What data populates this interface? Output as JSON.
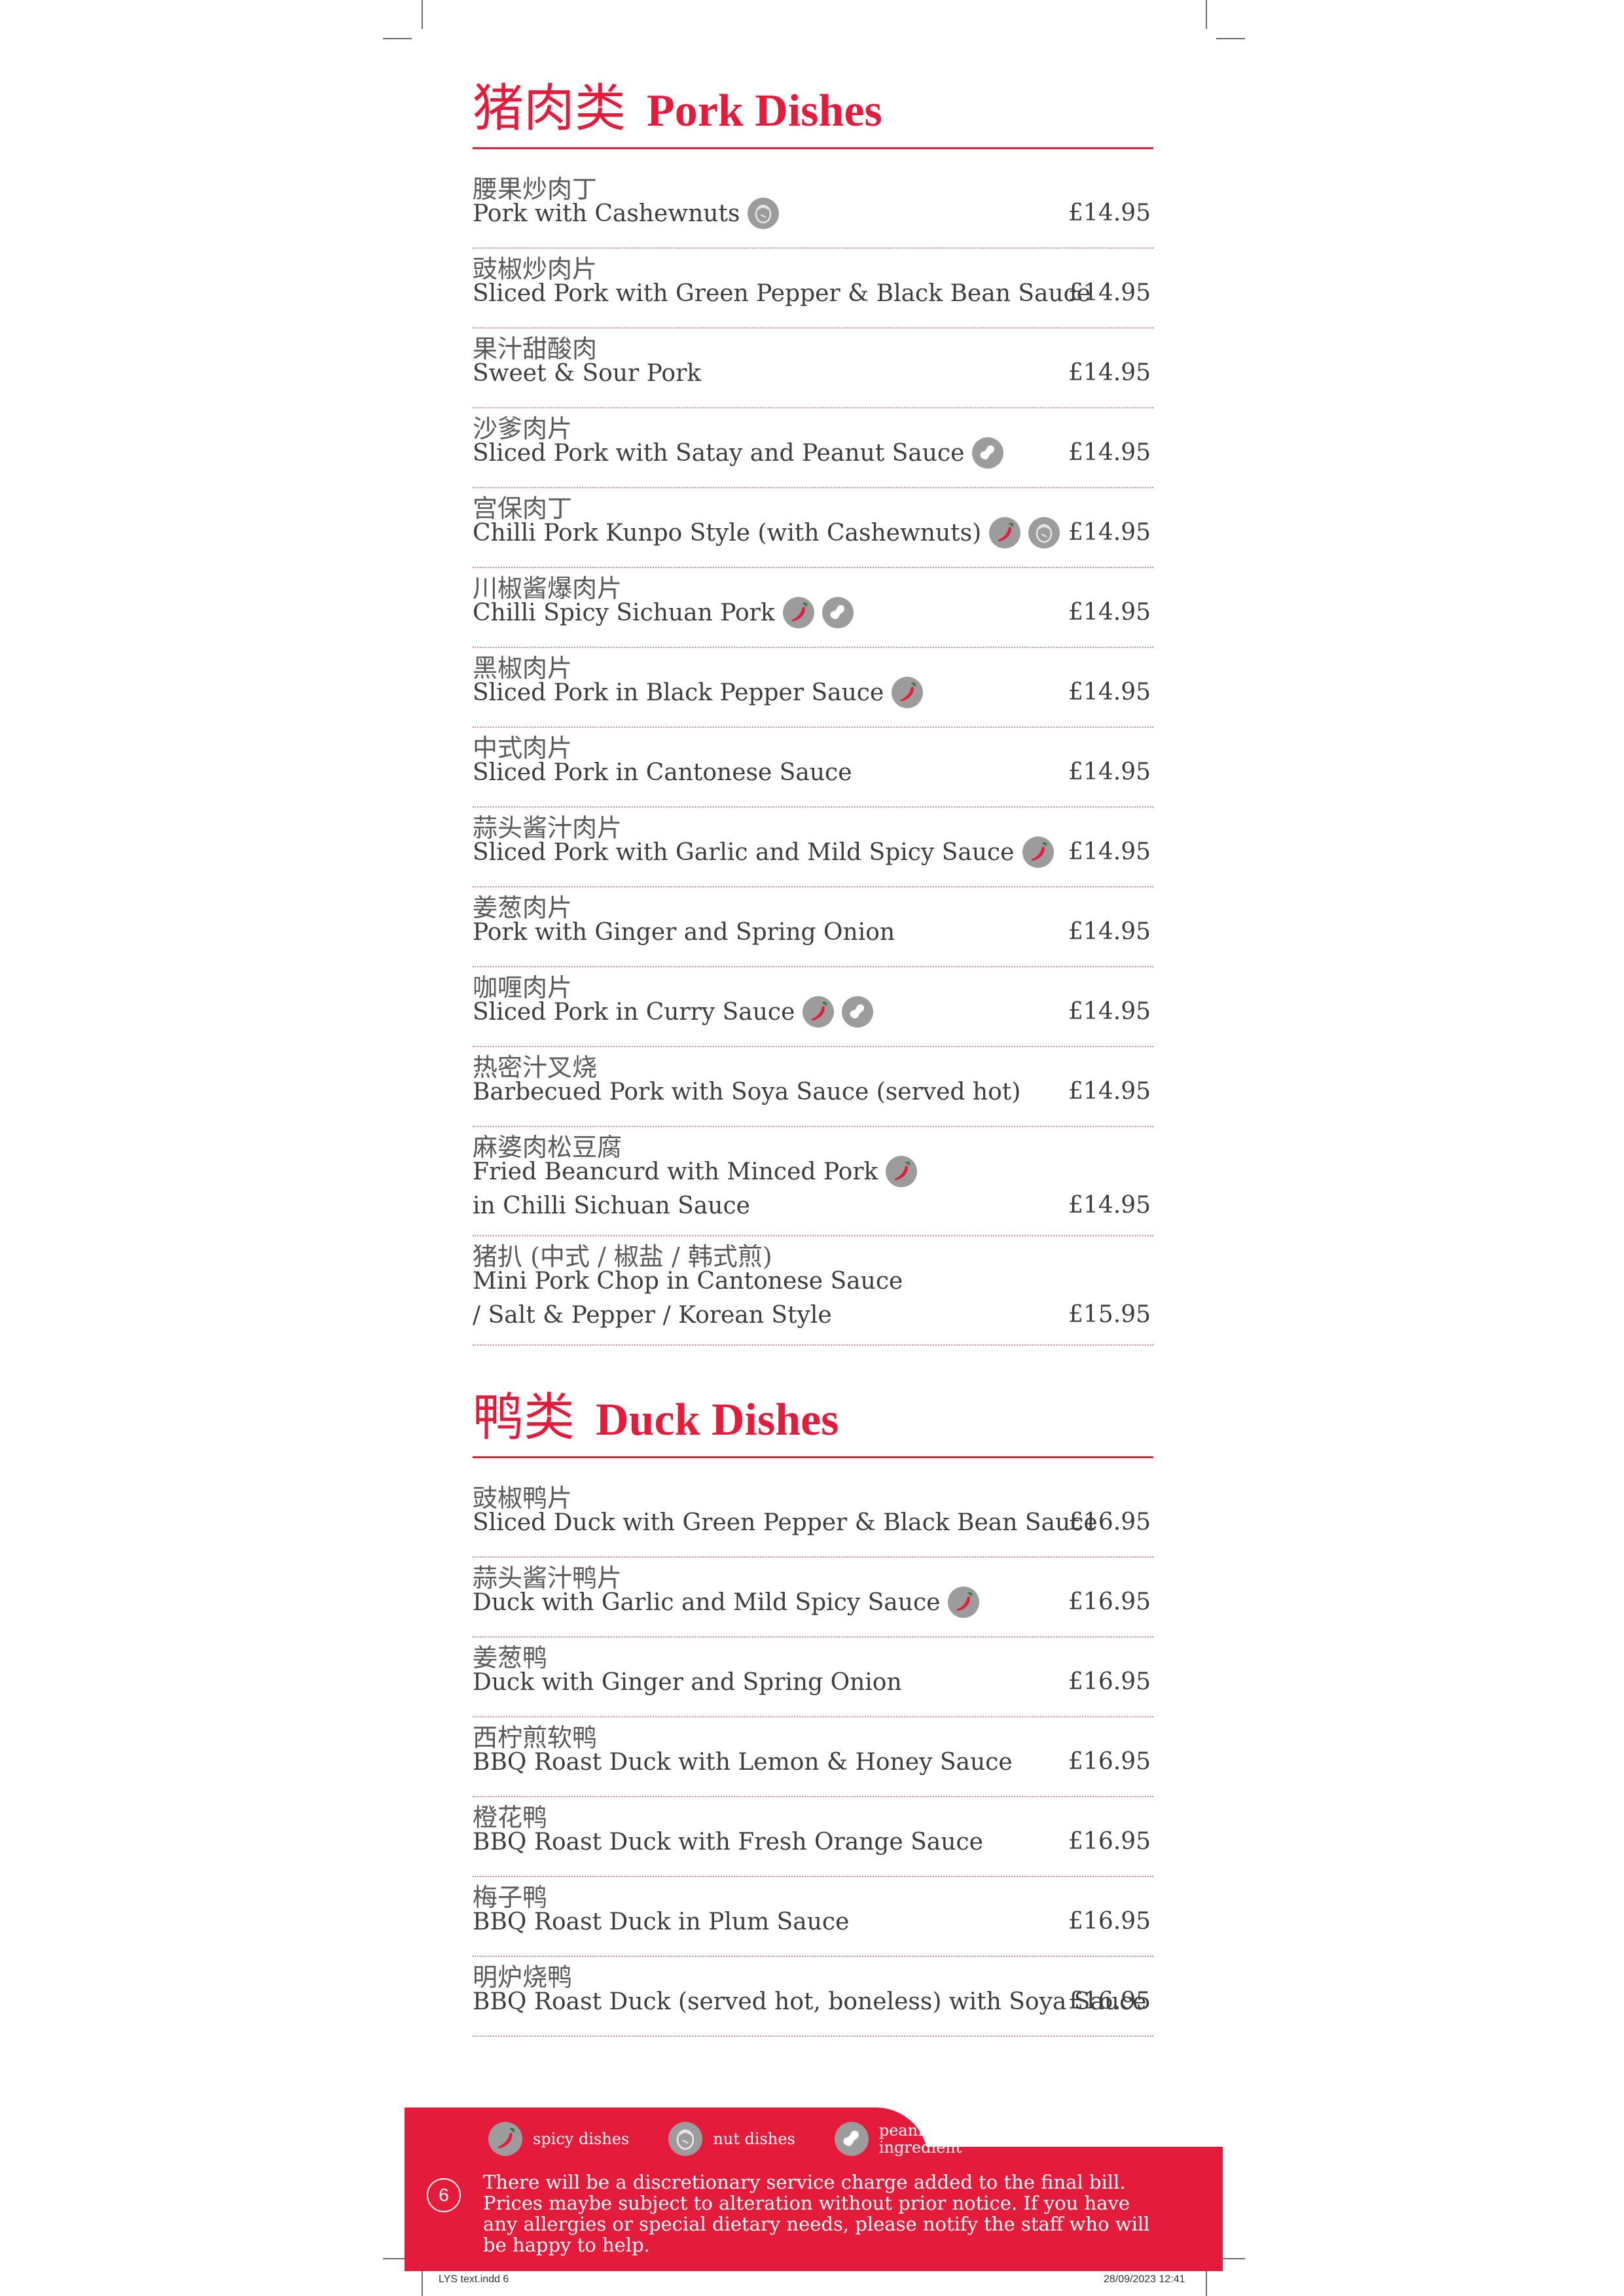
{
  "pork": {
    "title_zh": "猪肉类",
    "title_en": "Pork Dishes",
    "items": [
      {
        "zh": "腰果炒肉丁",
        "en": "Pork with Cashewnuts",
        "price": "£14.95",
        "icons": [
          "nut"
        ]
      },
      {
        "zh": "豉椒炒肉片",
        "en": "Sliced Pork with Green Pepper & Black Bean Sauce",
        "price": "£14.95",
        "icons": []
      },
      {
        "zh": "果汁甜酸肉",
        "en": "Sweet & Sour Pork",
        "price": "£14.95",
        "icons": []
      },
      {
        "zh": "沙爹肉片",
        "en": "Sliced Pork with Satay and Peanut Sauce",
        "price": "£14.95",
        "icons": [
          "peanut"
        ]
      },
      {
        "zh": "宫保肉丁",
        "en": "Chilli Pork Kunpo Style (with Cashewnuts)",
        "price": "£14.95",
        "icons": [
          "spicy",
          "nut"
        ]
      },
      {
        "zh": "川椒酱爆肉片",
        "en": "Chilli Spicy Sichuan Pork",
        "price": "£14.95",
        "icons": [
          "spicy",
          "peanut"
        ]
      },
      {
        "zh": "黑椒肉片",
        "en": "Sliced Pork in Black Pepper Sauce",
        "price": "£14.95",
        "icons": [
          "spicy"
        ]
      },
      {
        "zh": "中式肉片",
        "en": "Sliced Pork in Cantonese Sauce",
        "price": "£14.95",
        "icons": []
      },
      {
        "zh": "蒜头酱汁肉片",
        "en": "Sliced Pork with Garlic and Mild Spicy Sauce",
        "price": "£14.95",
        "icons": [
          "spicy"
        ]
      },
      {
        "zh": "姜葱肉片",
        "en": "Pork with Ginger and Spring Onion",
        "price": "£14.95",
        "icons": []
      },
      {
        "zh": "咖喱肉片",
        "en": "Sliced Pork in Curry Sauce",
        "price": "£14.95",
        "icons": [
          "spicy",
          "peanut"
        ]
      },
      {
        "zh": "热密汁叉烧",
        "en": "Barbecued Pork with Soya Sauce (served hot)",
        "price": "£14.95",
        "icons": []
      },
      {
        "zh": "麻婆肉松豆腐",
        "en": "Fried Beancurd with Minced Pork",
        "en2": "in Chilli Sichuan Sauce",
        "price": "£14.95",
        "icons": [
          "spicy"
        ]
      },
      {
        "zh": "猪扒 (中式 / 椒盐 / 韩式煎)",
        "en": "Mini Pork Chop in Cantonese Sauce",
        "en2": "/ Salt & Pepper / Korean Style",
        "price": "£15.95",
        "icons": []
      }
    ]
  },
  "duck": {
    "title_zh": "鸭类",
    "title_en": "Duck Dishes",
    "items": [
      {
        "zh": "豉椒鸭片",
        "en": "Sliced Duck with Green Pepper & Black Bean Sauce",
        "price": "£16.95",
        "icons": []
      },
      {
        "zh": "蒜头酱汁鸭片",
        "en": "Duck with Garlic and Mild Spicy Sauce",
        "price": "£16.95",
        "icons": [
          "spicy"
        ]
      },
      {
        "zh": "姜葱鸭",
        "en": "Duck with Ginger and Spring Onion",
        "price": "£16.95",
        "icons": []
      },
      {
        "zh": "西柠煎软鸭",
        "en": "BBQ Roast Duck with Lemon & Honey Sauce",
        "price": "£16.95",
        "icons": []
      },
      {
        "zh": "橙花鸭",
        "en": "BBQ Roast Duck with Fresh Orange Sauce",
        "price": "£16.95",
        "icons": []
      },
      {
        "zh": "梅子鸭",
        "en": "BBQ Roast Duck in Plum Sauce",
        "price": "£16.95",
        "icons": []
      },
      {
        "zh": "明炉烧鸭",
        "en": "BBQ Roast Duck (served hot, boneless) with Soya Sauce",
        "price": "£16.95",
        "icons": []
      }
    ]
  },
  "legend": [
    {
      "icon": "spicy",
      "label": "spicy dishes"
    },
    {
      "icon": "nut",
      "label": "nut dishes"
    },
    {
      "icon": "peanut",
      "label": "peannut ingredient"
    }
  ],
  "footer": {
    "page_number": "6",
    "notice": "There will be a discretionary service charge added to the final bill. Prices maybe subject to alteration without prior notice. If you have any allergies or special dietary needs, please notify the staff who will be happy to help."
  },
  "slug": {
    "file": "LYS text.indd  6",
    "date": "28/09/2023  12:41"
  },
  "colors": {
    "accent": "#e41b3b",
    "icon_grey": "#9c9c9c",
    "text": "#3d3d3d"
  }
}
